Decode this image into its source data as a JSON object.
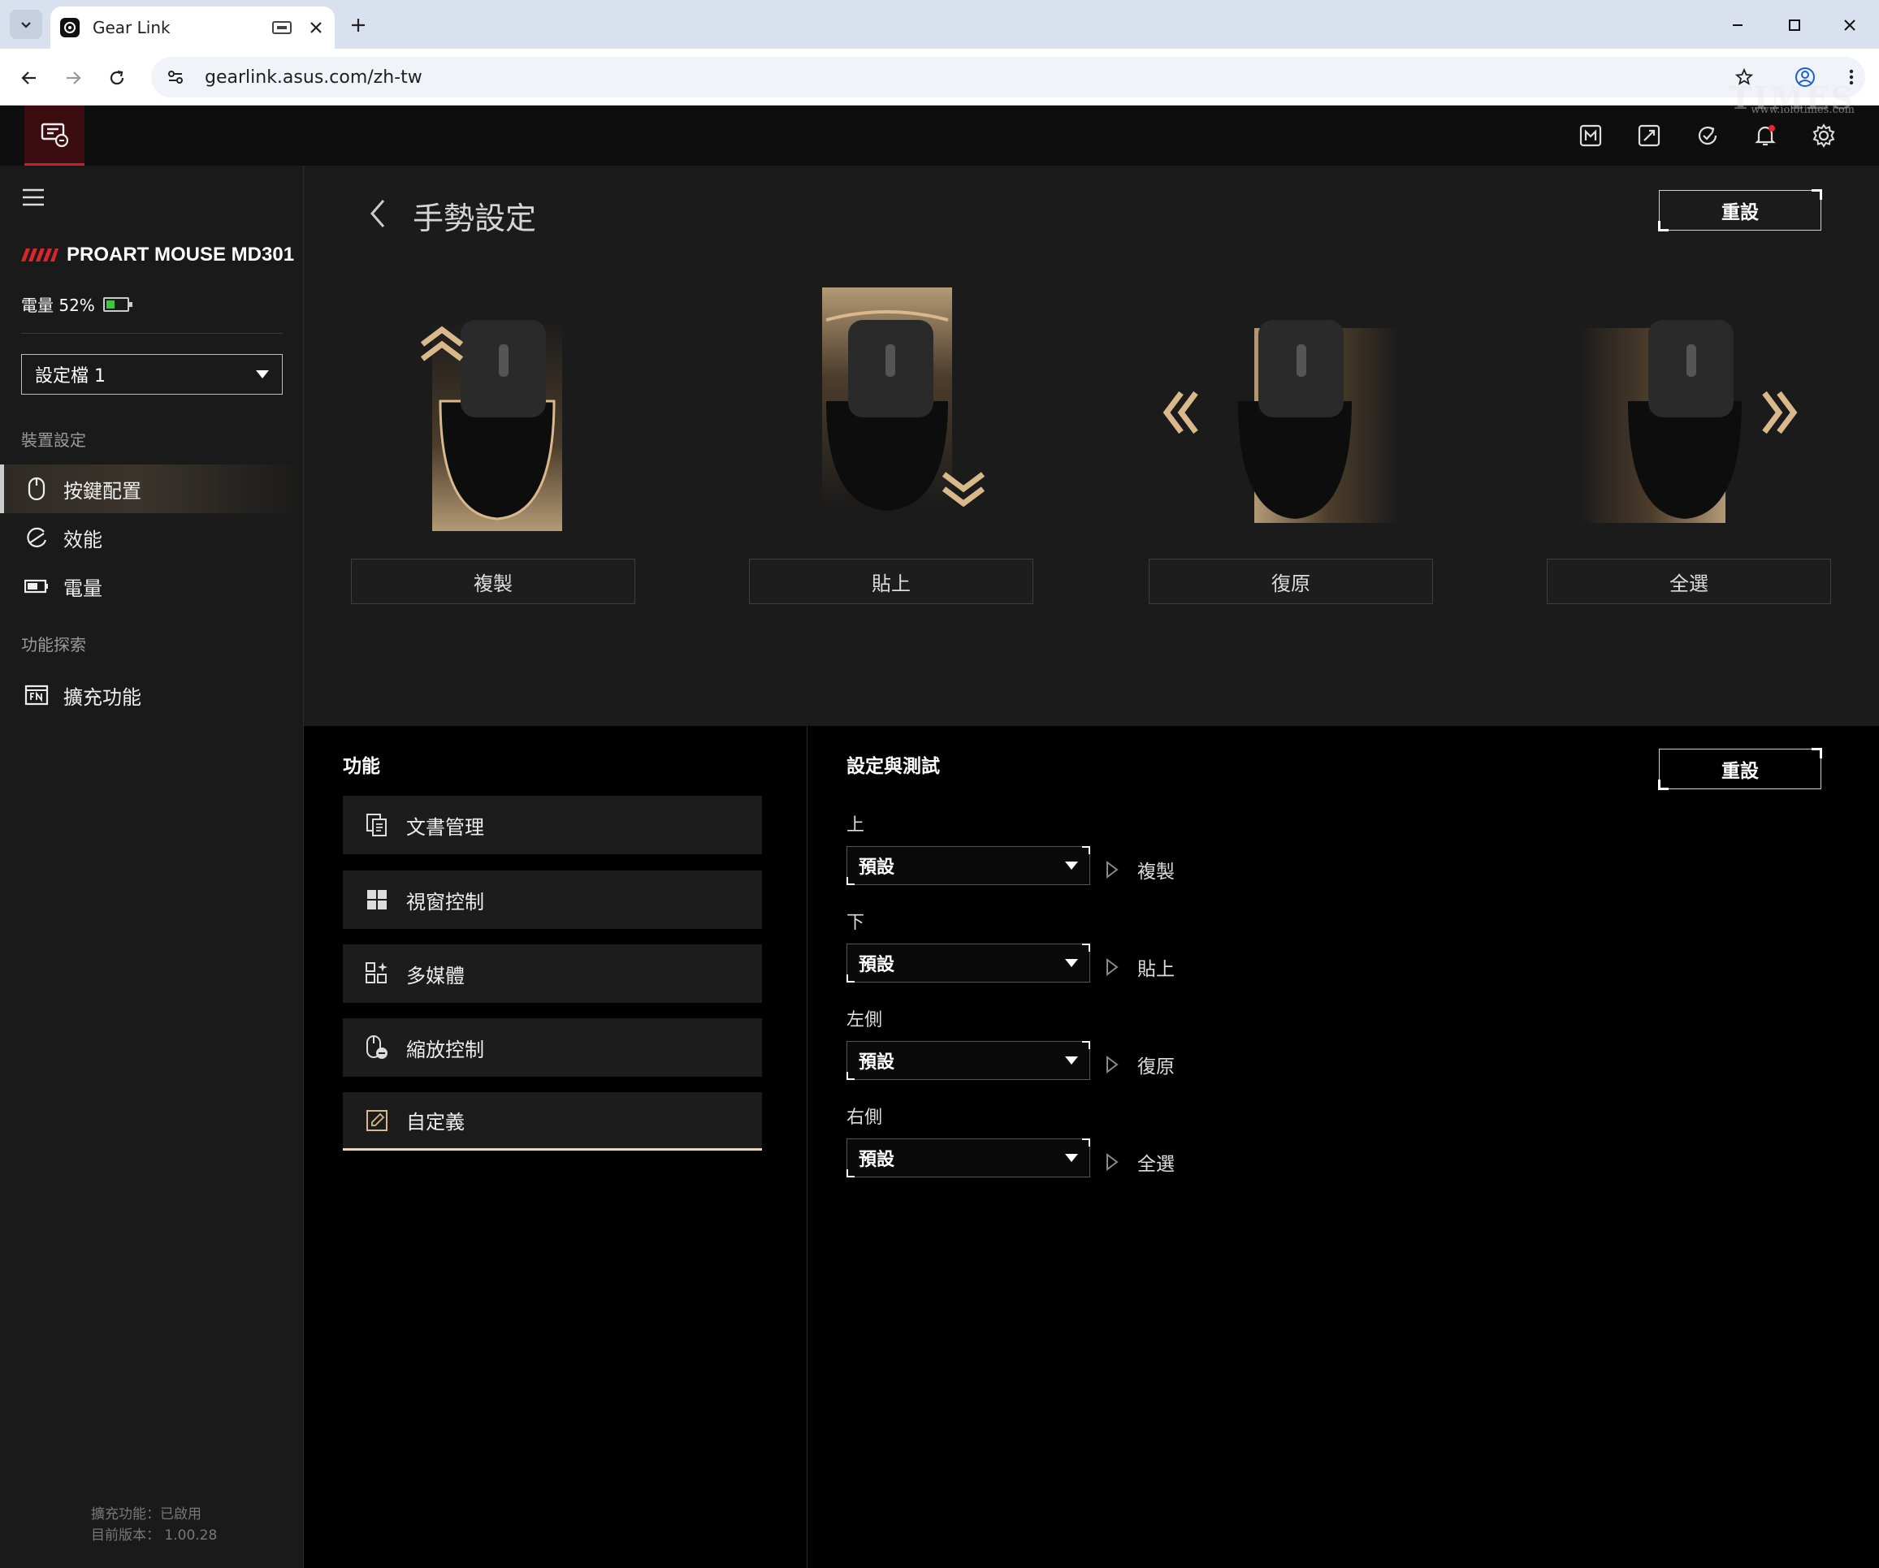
{
  "browser": {
    "tab_title": "Gear Link",
    "url": "gearlink.asus.com/zh-tw"
  },
  "watermark": {
    "text": "TIMES",
    "sub": "www.iolotimes.com"
  },
  "sidebar": {
    "device_name": "PROART MOUSE MD301",
    "battery_text": "電量 52%",
    "battery_level": 0.52,
    "profile": "設定檔 1",
    "section_device": "裝置設定",
    "items": [
      {
        "label": "按鍵配置",
        "icon": "mouse-icon",
        "active": true
      },
      {
        "label": "效能",
        "icon": "performance-icon",
        "active": false
      },
      {
        "label": "電量",
        "icon": "battery-icon",
        "active": false
      }
    ],
    "section_explore": "功能探索",
    "explore_items": [
      {
        "label": "擴充功能",
        "icon": "fn-icon"
      }
    ],
    "footer_ext": "擴充功能：已啟用",
    "footer_ver": "目前版本： 1.00.28"
  },
  "main": {
    "title": "手勢設定",
    "reset": "重設",
    "gestures": [
      {
        "label": "複製",
        "direction": "up"
      },
      {
        "label": "貼上",
        "direction": "down"
      },
      {
        "label": "復原",
        "direction": "left"
      },
      {
        "label": "全選",
        "direction": "right"
      }
    ]
  },
  "functions": {
    "title": "功能",
    "items": [
      {
        "label": "文書管理",
        "icon": "document-icon"
      },
      {
        "label": "視窗控制",
        "icon": "windows-icon"
      },
      {
        "label": "多媒體",
        "icon": "multimedia-icon"
      },
      {
        "label": "縮放控制",
        "icon": "zoom-icon"
      },
      {
        "label": "自定義",
        "icon": "custom-edit-icon",
        "active": true
      }
    ]
  },
  "settings": {
    "title": "設定與測試",
    "reset": "重設",
    "rows": [
      {
        "dir": "上",
        "value": "預設",
        "result": "複製"
      },
      {
        "dir": "下",
        "value": "預設",
        "result": "貼上"
      },
      {
        "dir": "左側",
        "value": "預設",
        "result": "復原"
      },
      {
        "dir": "右側",
        "value": "預設",
        "result": "全選"
      }
    ]
  },
  "colors": {
    "accent_gold": "#d9b98c",
    "brand_red": "#c8202e",
    "battery_green": "#3ec63e"
  }
}
